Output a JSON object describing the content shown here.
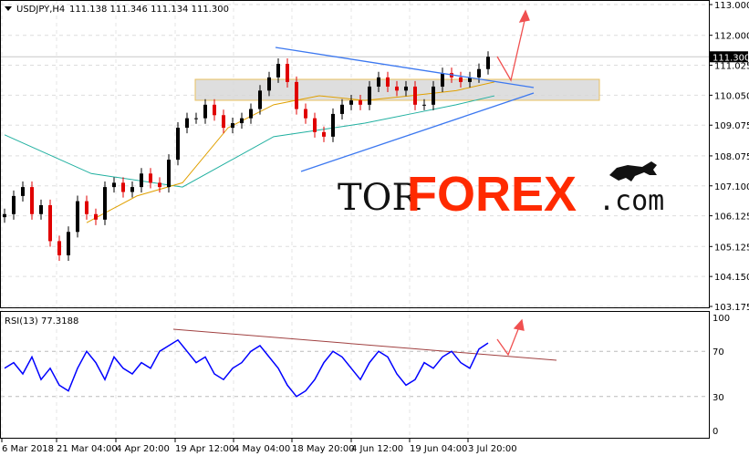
{
  "header": {
    "symbol_title": "USDJPY,H4",
    "ohlc": "111.138 111.346 111.134 111.300"
  },
  "rsi_header": {
    "title": "RSI(13) 77.3188"
  },
  "logo": {
    "part1": "TOR",
    "part2": "FOREX",
    "part3": ".com"
  },
  "colors": {
    "up": "#000000",
    "down": "#e00000",
    "ma_fast": "#e0a000",
    "ma_slow": "#20b0a0",
    "rsi": "#0000ff",
    "trend": "#3c78f0",
    "rsi_trend": "#a04040",
    "arrow": "#f05050",
    "logo_red": "#ff2a00"
  },
  "chart_data": [
    {
      "type": "candlestick",
      "title": "USDJPY,H4",
      "ylim": [
        103.175,
        113.0
      ],
      "yticks": [
        113.0,
        112.0,
        111.025,
        110.05,
        109.075,
        108.075,
        107.1,
        106.125,
        105.125,
        104.15,
        103.175
      ],
      "ytick_labels": [
        "113.000",
        "112.000",
        "111.025",
        "110.050",
        "109.075",
        "108.075",
        "107.100",
        "106.125",
        "105.125",
        "104.150",
        "103.175"
      ],
      "current_price": 111.3,
      "current_price_label": "111.300",
      "xtick_labels": [
        "6 Mar 2018",
        "21 Mar 04:00",
        "4 Apr 20:00",
        "19 Apr 12:00",
        "4 May 04:00",
        "18 May 20:00",
        "4 Jun 12:00",
        "19 Jun 04:00",
        "3 Jul 20:00"
      ],
      "xtick_index": [
        0,
        6,
        12.5,
        19,
        25.4,
        31.8,
        38.3,
        44.7,
        51.1
      ],
      "closes": [
        106.18,
        106.77,
        107.06,
        106.18,
        106.47,
        105.3,
        104.84,
        105.6,
        106.6,
        106.18,
        106.0,
        107.06,
        107.2,
        106.9,
        107.06,
        107.5,
        107.2,
        107.06,
        107.95,
        108.99,
        109.3,
        109.3,
        109.74,
        109.4,
        108.99,
        109.14,
        109.3,
        109.6,
        110.2,
        110.63,
        111.07,
        110.48,
        109.6,
        109.3,
        108.85,
        108.7,
        109.44,
        109.74,
        109.88,
        109.74,
        110.33,
        110.63,
        110.33,
        110.2,
        110.33,
        109.74,
        109.74,
        110.33,
        110.77,
        110.63,
        110.48,
        110.63,
        110.9,
        111.3
      ],
      "ma_fast": {
        "index": [
          9,
          14.5,
          19.5,
          24.5,
          29.5,
          34.5,
          39.5,
          44.5,
          49.5,
          53.7
        ],
        "values": [
          105.9,
          106.77,
          107.2,
          108.99,
          109.74,
          110.03,
          109.88,
          110.03,
          110.2,
          110.48
        ]
      },
      "ma_slow": {
        "index": [
          0,
          9.5,
          19.5,
          29.5,
          39.5,
          44.5,
          49.5,
          53.7
        ],
        "values": [
          108.76,
          107.5,
          107.06,
          108.7,
          109.14,
          109.44,
          109.74,
          110.03
        ]
      }
    },
    {
      "type": "line",
      "title": "RSI(13)",
      "ylim": [
        0,
        100
      ],
      "yticks": [
        100,
        70,
        30,
        0
      ],
      "ytick_labels": [
        "100",
        "70",
        "30",
        "0"
      ],
      "values": [
        55,
        60,
        50,
        65,
        45,
        55,
        40,
        35,
        55,
        70,
        60,
        45,
        65,
        55,
        50,
        60,
        55,
        70,
        75,
        80,
        70,
        60,
        65,
        50,
        45,
        55,
        60,
        70,
        75,
        65,
        55,
        40,
        30,
        35,
        45,
        60,
        70,
        65,
        55,
        45,
        60,
        70,
        65,
        50,
        40,
        45,
        60,
        55,
        65,
        70,
        60,
        55,
        72,
        77.3
      ]
    }
  ]
}
